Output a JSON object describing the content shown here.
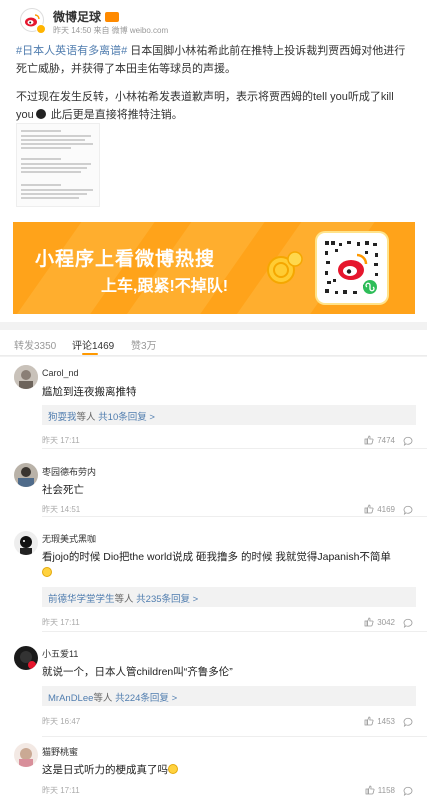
{
  "post": {
    "author": "微博足球",
    "meta": "昨天 14:50 来自 微博 weibo.com",
    "hashtag": "#日本人英语有多离谱#",
    "paragraph1": " 日本国脚小林祐希此前在推特上投诉裁判贾西姆对他进行死亡威胁，并获得了本田圭佑等球员的声援。",
    "paragraph2_a": "不过现在发生反转，小林祐希发表道歉声明，表示将贾西姆的tell you听成了kill you",
    "paragraph2_b": " 此后更是直接将推特注销。"
  },
  "banner": {
    "title": "小程序上看微博热搜",
    "subtitle": "上车,跟紧!不掉队!"
  },
  "tabs": {
    "repost": "转发3350",
    "comment": "评论1469",
    "like": "赞3万"
  },
  "comments": [
    {
      "user": "Carol_nd",
      "text": "尴尬到连夜搬离推特",
      "reply_user": "狗耍我",
      "reply_mid": "等人",
      "reply_count": "共10条回复 >",
      "time": "昨天 17:11",
      "likes": "7474"
    },
    {
      "user": "枣园德布劳内",
      "text": "社会死亡",
      "time": "昨天 14:51",
      "likes": "4169"
    },
    {
      "user": "无瑕美式黑咖",
      "text": "看jojo的时候 Dio把the world说成 砸我撸多 的时候 我就觉得Japanish不简单",
      "reply_user": "前德华学堂学生",
      "reply_mid": "等人",
      "reply_count": "共235条回复 >",
      "time": "昨天 17:11",
      "likes": "3042"
    },
    {
      "user": "小五爱11",
      "text": "就说一个，日本人管children叫“齐鲁多伦”",
      "reply_user": "MrAnDLee",
      "reply_mid": "等人",
      "reply_count": "共224条回复 >",
      "time": "昨天 16:47",
      "likes": "1453"
    },
    {
      "user": "猫野桃蜜",
      "text": "这是日式听力的梗成真了吗",
      "time": "昨天 17:11",
      "likes": "1158"
    }
  ],
  "colors": {
    "link": "#507daf",
    "accent": "#ff9900",
    "banner": "#ffa31a"
  },
  "icons": [
    "weibo-logo-icon",
    "vip-badge-icon",
    "thumb-up-icon",
    "reply-bubble-icon",
    "qr-code-icon",
    "emoji-icon"
  ]
}
